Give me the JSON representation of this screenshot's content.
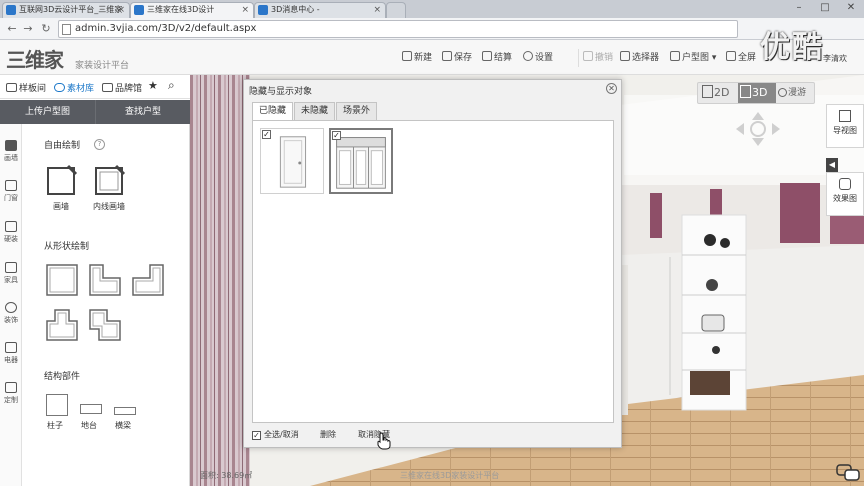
{
  "browser": {
    "tabs": [
      {
        "label": "互联网3D云设计平台_三维家",
        "active": false
      },
      {
        "label": "三维家在线3D设计",
        "active": true
      },
      {
        "label": "3D消息中心 -",
        "active": false
      }
    ],
    "url": "admin.3vjia.com/3D/v2/default.aspx",
    "watermark": "优酷"
  },
  "app": {
    "logo": "三维家",
    "logo_sub": "家装设计平台",
    "toolbar": {
      "new": "新建",
      "save": "保存",
      "checkout": "结算",
      "settings": "设置",
      "undo": "撤销",
      "selector": "选择器",
      "floorplan": "户型图",
      "fullscreen": "全屏",
      "user": "李清欢"
    }
  },
  "left_panel": {
    "tabs": [
      "样板间",
      "素材库",
      "品牌馆"
    ],
    "actions": [
      "上传户型图",
      "查找户型"
    ],
    "side_nav": [
      "画墙",
      "门窗",
      "硬装",
      "家具",
      "装饰",
      "电器",
      "定制"
    ],
    "free_draw": {
      "title": "自由绘制",
      "items": [
        "画墙",
        "内线画墙"
      ]
    },
    "shape_draw": {
      "title": "从形状绘制"
    },
    "structure": {
      "title": "结构部件",
      "items": [
        "柱子",
        "地台",
        "横梁"
      ]
    }
  },
  "view": {
    "modes": [
      "2D",
      "3D",
      "漫游"
    ],
    "active_mode": "3D",
    "right_buttons": [
      "导视图",
      "效果图"
    ]
  },
  "dialog": {
    "title": "隐藏与显示对象",
    "tabs": [
      "已隐藏",
      "未隐藏",
      "场景外"
    ],
    "active_tab": "已隐藏",
    "items": [
      {
        "name": "door-thumbnail",
        "checked": true
      },
      {
        "name": "cabinet-thumbnail",
        "checked": true
      }
    ],
    "footer": {
      "select_all": "全选/取消",
      "delete": "删除",
      "unhide": "取消隐藏"
    }
  },
  "status": {
    "area_label": "面积",
    "area_value": "38.69㎡",
    "ghost_text": "三维家在线3D家装设计平台"
  }
}
